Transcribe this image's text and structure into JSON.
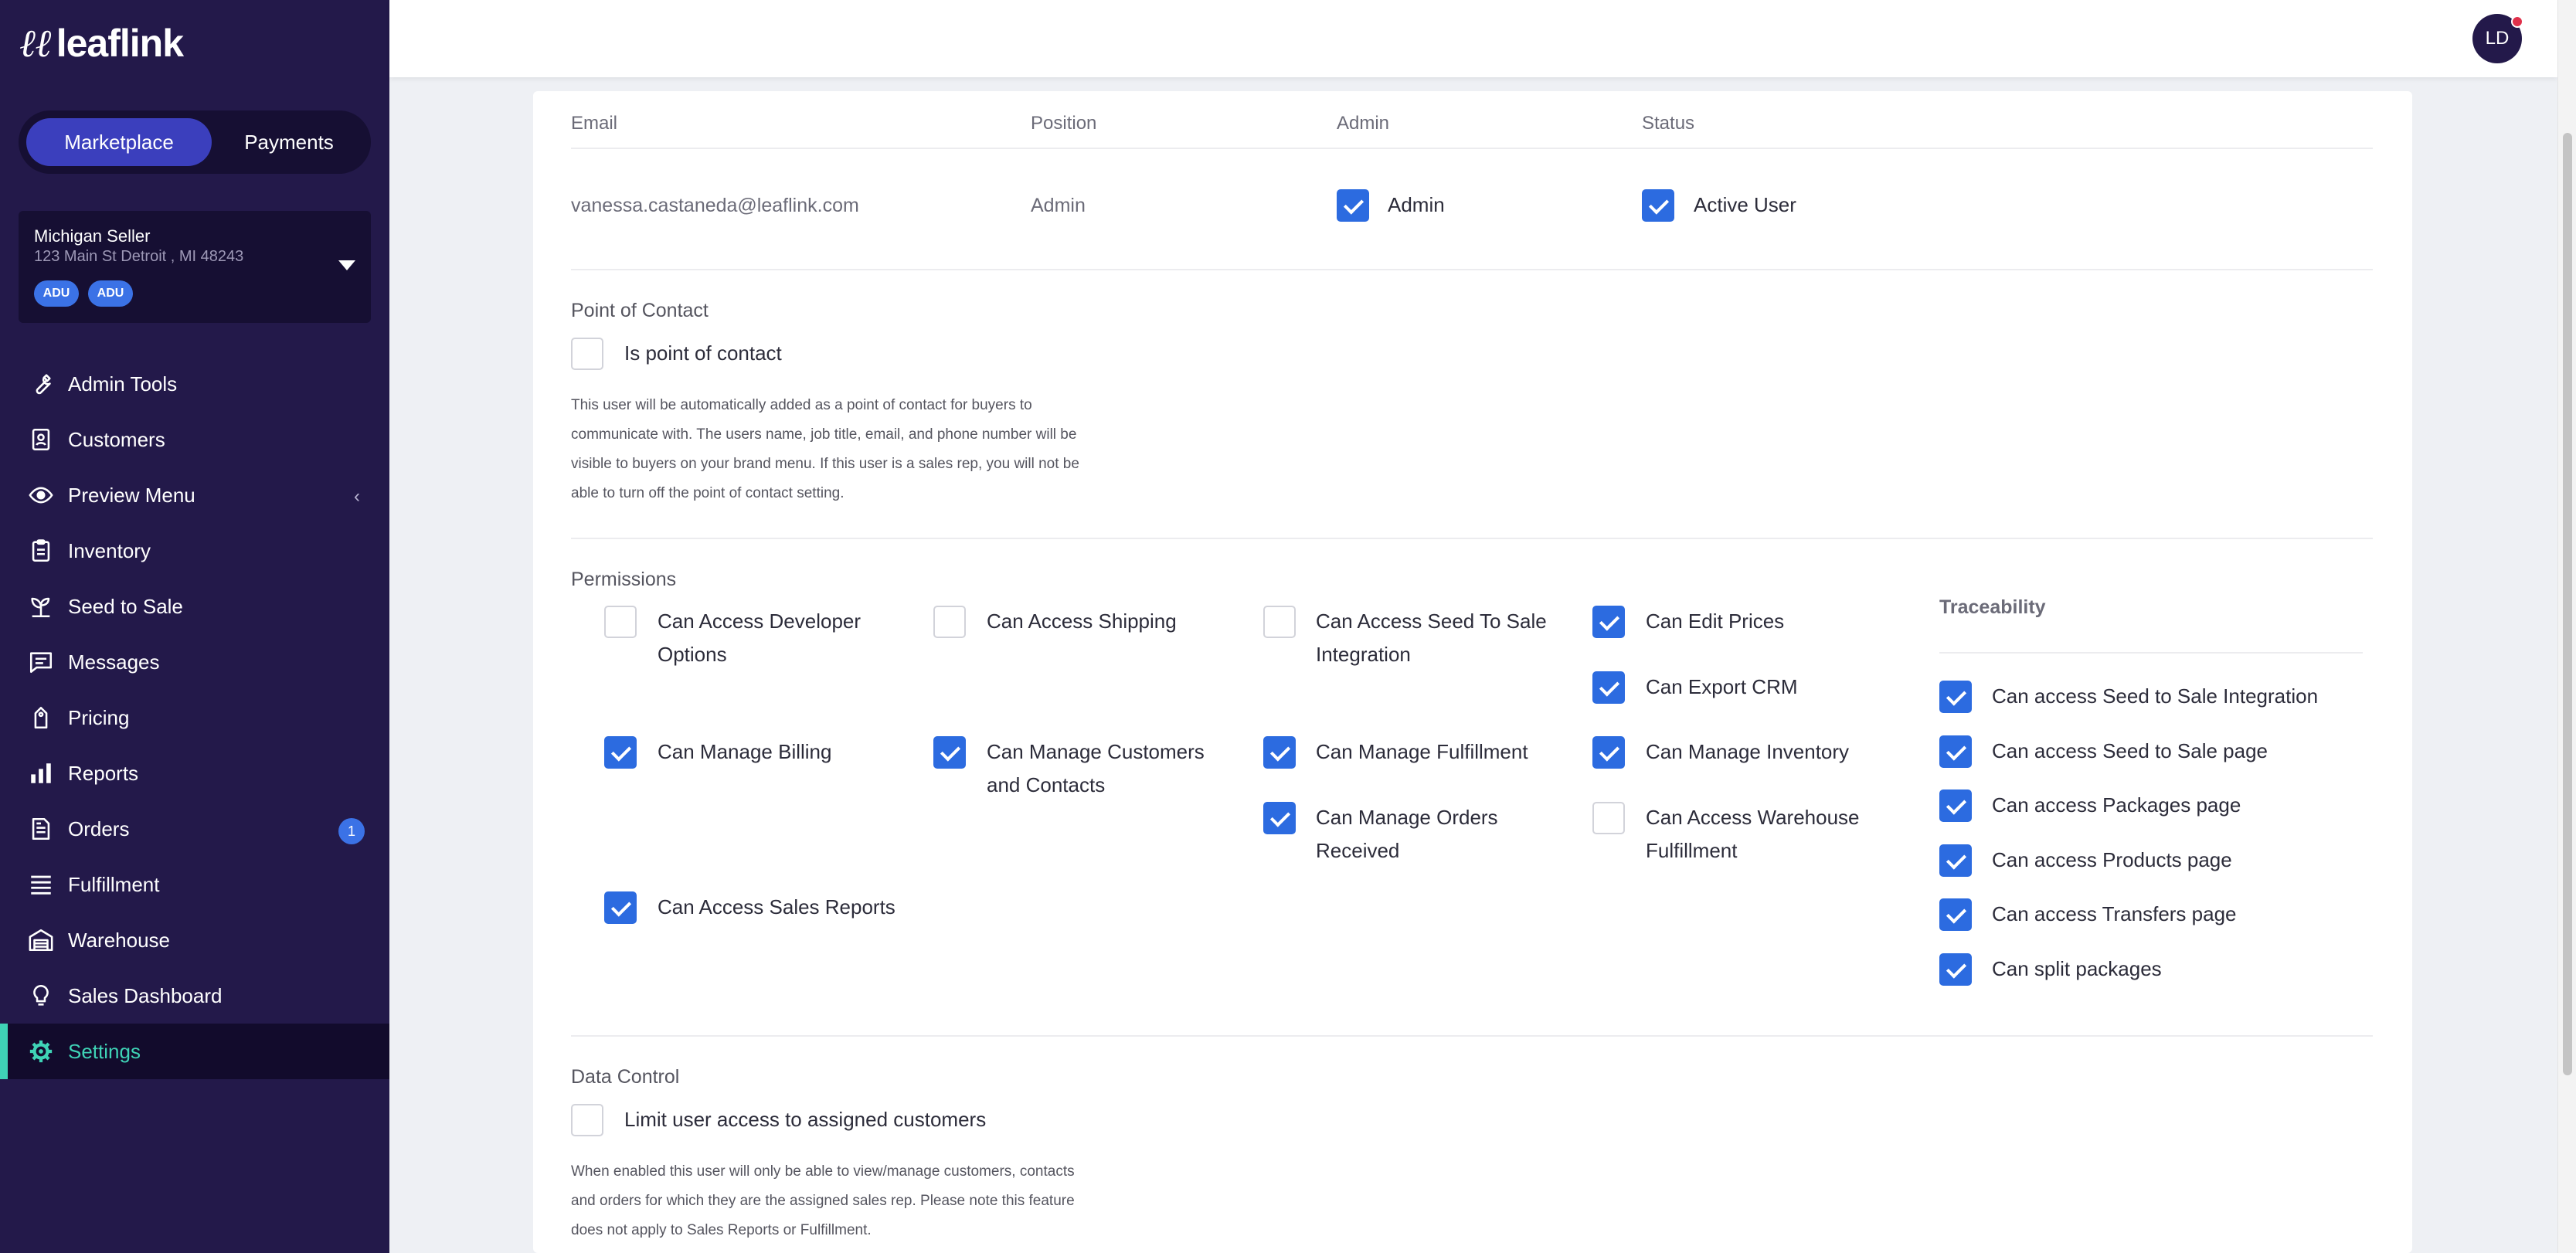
{
  "brand": {
    "name": "leaflink",
    "mark": "ℓℓ"
  },
  "sidebar": {
    "segments": {
      "marketplace": "Marketplace",
      "payments": "Payments"
    },
    "store": {
      "name": "Michigan Seller",
      "address": "123 Main St Detroit , MI 48243",
      "badges": [
        "ADU",
        "ADU"
      ]
    },
    "nav": [
      {
        "label": "Admin Tools",
        "icon": "wrench-icon"
      },
      {
        "label": "Customers",
        "icon": "contact-book-icon"
      },
      {
        "label": "Preview Menu",
        "icon": "eye-icon"
      },
      {
        "label": "Inventory",
        "icon": "clipboard-icon"
      },
      {
        "label": "Seed to Sale",
        "icon": "seedling-icon"
      },
      {
        "label": "Messages",
        "icon": "message-icon"
      },
      {
        "label": "Pricing",
        "icon": "price-tag-icon"
      },
      {
        "label": "Reports",
        "icon": "bar-chart-icon"
      },
      {
        "label": "Orders",
        "icon": "document-icon",
        "badge": "1"
      },
      {
        "label": "Fulfillment",
        "icon": "list-lines-icon"
      },
      {
        "label": "Warehouse",
        "icon": "warehouse-icon"
      },
      {
        "label": "Sales Dashboard",
        "icon": "lightbulb-icon"
      },
      {
        "label": "Settings",
        "icon": "gear-icon",
        "active": true
      }
    ],
    "preview_chevron": "‹"
  },
  "header": {
    "avatar_initials": "LD"
  },
  "user": {
    "headers": {
      "email": "Email",
      "position": "Position",
      "admin": "Admin",
      "status": "Status"
    },
    "email": "vanessa.castaneda@leaflink.com",
    "position": "Admin",
    "admin_label": "Admin",
    "status_label": "Active User"
  },
  "point_of_contact": {
    "title": "Point of Contact",
    "checkbox_label": "Is point of contact",
    "help": [
      "This user will be automatically added as a point of contact for buyers to",
      "communicate with. The users name, job title, email, and phone number will be",
      "visible to buyers on your brand menu. If this user is a sales rep, you will not be",
      "able to turn off the point of contact setting."
    ]
  },
  "permissions": {
    "title": "Permissions",
    "items": {
      "developer": {
        "line1": "Can Access Developer",
        "line2": "Options"
      },
      "shipping": {
        "line1": "Can Access Shipping"
      },
      "seed_to_sale_integration": {
        "line1": "Can Access Seed To Sale",
        "line2": "Integration"
      },
      "edit_prices": {
        "line1": "Can Edit Prices"
      },
      "export_crm": {
        "line1": "Can Export CRM"
      },
      "manage_billing": {
        "line1": "Can Manage Billing"
      },
      "manage_customers": {
        "line1": "Can Manage Customers",
        "line2": "and Contacts"
      },
      "manage_fulfillment": {
        "line1": "Can Manage Fulfillment"
      },
      "manage_inventory": {
        "line1": "Can Manage Inventory"
      },
      "manage_orders": {
        "line1": "Can Manage Orders",
        "line2": "Received"
      },
      "warehouse_fulfillment": {
        "line1": "Can Access Warehouse",
        "line2": "Fulfillment"
      },
      "sales_reports": {
        "line1": "Can Access Sales Reports"
      }
    }
  },
  "traceability": {
    "title": "Traceability",
    "items": [
      "Can access Seed to Sale Integration",
      "Can access Seed to Sale page",
      "Can access Packages page",
      "Can access Products page",
      "Can access Transfers page",
      "Can split packages"
    ]
  },
  "data_control": {
    "title": "Data Control",
    "checkbox_label": "Limit user access to assigned customers",
    "help": [
      "When enabled this user will only be able to view/manage customers, contacts",
      "and orders for which they are the assigned sales rep. Please note this feature",
      "does not apply to Sales Reports or Fulfillment."
    ]
  },
  "colors": {
    "sidebar_bg": "#23194a",
    "accent": "#3b3fbd",
    "checkbox_on": "#2c6be0",
    "active_nav": "#3fd3b6"
  }
}
